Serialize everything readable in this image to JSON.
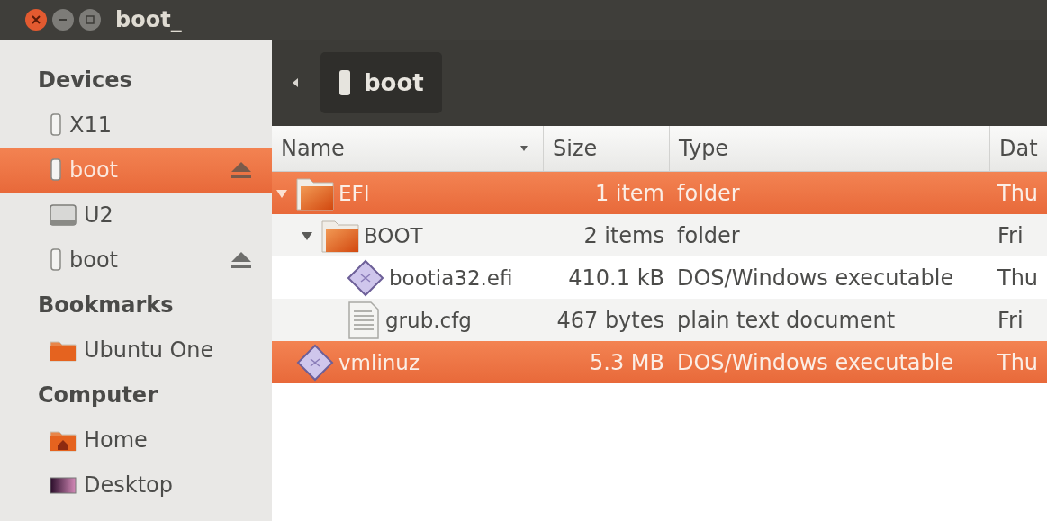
{
  "window": {
    "title": "boot_"
  },
  "sidebar": {
    "sections": [
      {
        "heading": "Devices",
        "items": [
          {
            "label": "X11",
            "kind": "usb",
            "selected": false,
            "ejectable": false
          },
          {
            "label": "boot",
            "kind": "usb",
            "selected": true,
            "ejectable": true
          },
          {
            "label": "U2",
            "kind": "disk",
            "selected": false,
            "ejectable": false
          },
          {
            "label": "boot",
            "kind": "usb",
            "selected": false,
            "ejectable": true
          }
        ]
      },
      {
        "heading": "Bookmarks",
        "items": [
          {
            "label": "Ubuntu One",
            "kind": "folder",
            "selected": false,
            "ejectable": false
          }
        ]
      },
      {
        "heading": "Computer",
        "items": [
          {
            "label": "Home",
            "kind": "home",
            "selected": false,
            "ejectable": false
          },
          {
            "label": "Desktop",
            "kind": "desktop",
            "selected": false,
            "ejectable": false
          }
        ]
      }
    ]
  },
  "path_bar": {
    "location": "boot"
  },
  "table": {
    "columns": [
      "Name",
      "Size",
      "Type",
      "Dat"
    ],
    "rows": [
      {
        "name": "EFI",
        "kind": "folder",
        "size": "1 item",
        "type": "folder",
        "date": "Thu",
        "selected": true,
        "expanded": true,
        "children": [
          {
            "name": "BOOT",
            "kind": "folder",
            "size": "2 items",
            "type": "folder",
            "date": "Fri",
            "selected": false,
            "expanded": true,
            "children": [
              {
                "name": "bootia32.efi",
                "kind": "executable",
                "size": "410.1 kB",
                "type": "DOS/Windows executable",
                "date": "Thu",
                "selected": false
              },
              {
                "name": "grub.cfg",
                "kind": "text",
                "size": "467 bytes",
                "type": "plain text document",
                "date": "Fri",
                "selected": false
              }
            ]
          }
        ]
      },
      {
        "name": "vmlinuz",
        "kind": "executable",
        "size": "5.3 MB",
        "type": "DOS/Windows executable",
        "date": "Thu",
        "selected": true
      }
    ]
  }
}
